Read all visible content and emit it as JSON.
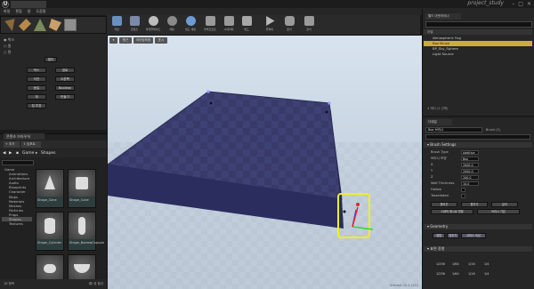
{
  "window": {
    "project_title": "project_study"
  },
  "menu": [
    "파일",
    "편집",
    "창",
    "도움말"
  ],
  "left_panel": {
    "radio_rows": [
      "박스",
      "원",
      "면"
    ],
    "buttons": [
      "멀티",
      "박스",
      "경로",
      "이전",
      "오른쪽",
      "동일",
      "Boolean",
      "재",
      "만들기",
      "칩 투표"
    ]
  },
  "content_browser": {
    "tab": "콘텐츠 브라우저",
    "add_label": "추가",
    "import_label": "임포트",
    "path": [
      "Game",
      "Shapes"
    ],
    "tree": [
      "Game",
      "Animations",
      "Architecture",
      "Audio",
      "Blueprints",
      "Character",
      "Maps",
      "Materials",
      "Meshes",
      "Particles",
      "Props",
      "Shapes",
      "Textures"
    ],
    "tree_selected": "Shapes",
    "assets": [
      "Shape_Cone",
      "Shape_Cube",
      "Shape_Cylinder",
      "Shape_NarrowCapsule",
      "",
      ""
    ],
    "status": "18 항목",
    "view_options": "뷰 옵션"
  },
  "toolbar": [
    {
      "label": "저장",
      "icon": "save-icon",
      "color": "#6a8fbf"
    },
    {
      "label": "콘텐츠",
      "icon": "content-icon",
      "color": "#7a7a7a"
    },
    {
      "label": "마켓플레이스",
      "icon": "marketplace-icon",
      "color": "#bdbdbd"
    },
    {
      "label": "세팅",
      "icon": "settings-icon",
      "color": "#8a8a8a"
    },
    {
      "label": "월드 세팅",
      "icon": "world-icon",
      "color": "#6c9cd3"
    },
    {
      "label": "블루프린트",
      "icon": "blueprint-icon",
      "color": "#9a9a9a"
    },
    {
      "label": "시네마틱",
      "icon": "cinematic-icon",
      "color": "#9a9a9a"
    },
    {
      "label": "빌드",
      "icon": "build-icon",
      "color": "#a8a8a8"
    },
    {
      "label": "플레이",
      "icon": "play-icon",
      "color": "#b8b8b8"
    },
    {
      "label": "론치",
      "icon": "launch-icon",
      "color": "#9a9a9a"
    },
    {
      "label": "장치",
      "icon": "device-icon",
      "color": "#9a9a9a"
    }
  ],
  "viewport": {
    "perspective": "원근",
    "lit": "라이팅포함",
    "show": "표시",
    "status_text": "Unlitled (0) 0 (1/0)"
  },
  "outliner": {
    "tab": "월드 아웃라이너",
    "header": "라벨",
    "items": [
      "Atmospheric Fog",
      "Box Brush",
      "BP_Sky_Sphere",
      "Light Source"
    ],
    "selected": "Box Brush",
    "footer": "4 액터 (1 선택)"
  },
  "details": {
    "tab": "디테일",
    "name": "Box 브러시",
    "name_right": "Brush (1)",
    "brush_section": "Brush Settings",
    "props": [
      {
        "k": "Brush Type",
        "v": "Additive"
      },
      {
        "k": "브러시 모양",
        "v": "Box"
      },
      {
        "k": "X",
        "v": "2000.0"
      },
      {
        "k": "Y",
        "v": "2000.0"
      },
      {
        "k": "Z",
        "v": "200.0"
      },
      {
        "k": "Wall Thickness",
        "v": "10.0"
      },
      {
        "k": "Hollow",
        "v": ""
      },
      {
        "k": "Tessellated",
        "v": ""
      }
    ],
    "buttons": [
      "폴리곤",
      "합치기",
      "분리",
      "스태틱 메시로 변환",
      "브러시 기본"
    ],
    "geometry_section": "Geometry",
    "geo_buttons": [
      "정렬",
      "맞추기",
      "서피스 속성"
    ],
    "grid_section": "표면 정렬",
    "grid_rows": [
      [
        "1/256",
        "1/64",
        "1/16",
        "1/4"
      ],
      [
        "1/256",
        "1/64",
        "1/16",
        "1/4"
      ]
    ]
  }
}
